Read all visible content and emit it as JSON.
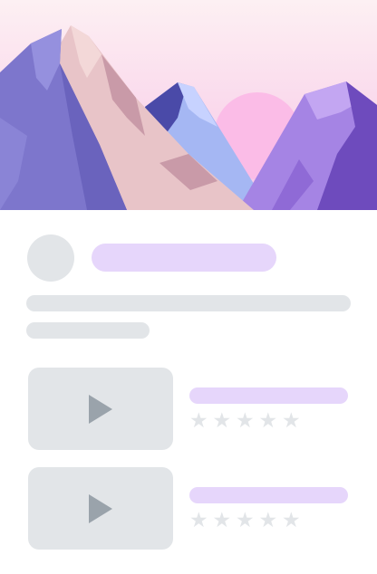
{
  "hero": {
    "image_icon": "mountain-landscape-illustration",
    "colors": {
      "sky_top": "#fde9f1",
      "sky_bottom": "#f6c3e6",
      "sun": "#fbbce7",
      "left_peak": "#7b74c9",
      "middle_peak": "#e7c4c9",
      "blue_peak": "#9fb2f1",
      "right_peak": "#9f7de0"
    }
  },
  "profile": {
    "avatar_icon": "avatar-placeholder"
  },
  "videos": [
    {
      "thumbnail_icon": "play-icon",
      "rating": 0,
      "rating_max": 5
    },
    {
      "thumbnail_icon": "play-icon",
      "rating": 0,
      "rating_max": 5
    }
  ],
  "stars": {
    "filled": "★",
    "empty": "★"
  },
  "colors": {
    "placeholder_gray": "#e2e5e8",
    "placeholder_purple": "#e6d6fb",
    "play_icon": "#9aa3ab"
  }
}
